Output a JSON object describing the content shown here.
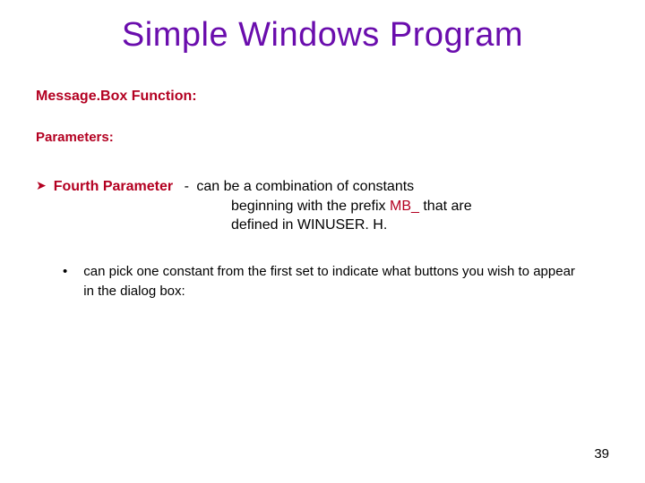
{
  "colors": {
    "title": "#6a0dad",
    "accent": "#b30021"
  },
  "title": "Simple Windows Program",
  "subtitle": "Message.Box Function:",
  "parametersLabel": "Parameters:",
  "param": {
    "arrow": "➤",
    "name": "Fourth Parameter",
    "sep": "-",
    "desc1": "can be a combination of constants",
    "desc2a": "beginning with the prefix ",
    "desc2b": "MB_",
    "desc2c": " that are",
    "desc3": "defined in WINUSER. H."
  },
  "subBullet": {
    "dot": "•",
    "text": "can pick one constant from the first set to indicate what buttons you wish to appear in the dialog box:"
  },
  "pageNumber": "39"
}
